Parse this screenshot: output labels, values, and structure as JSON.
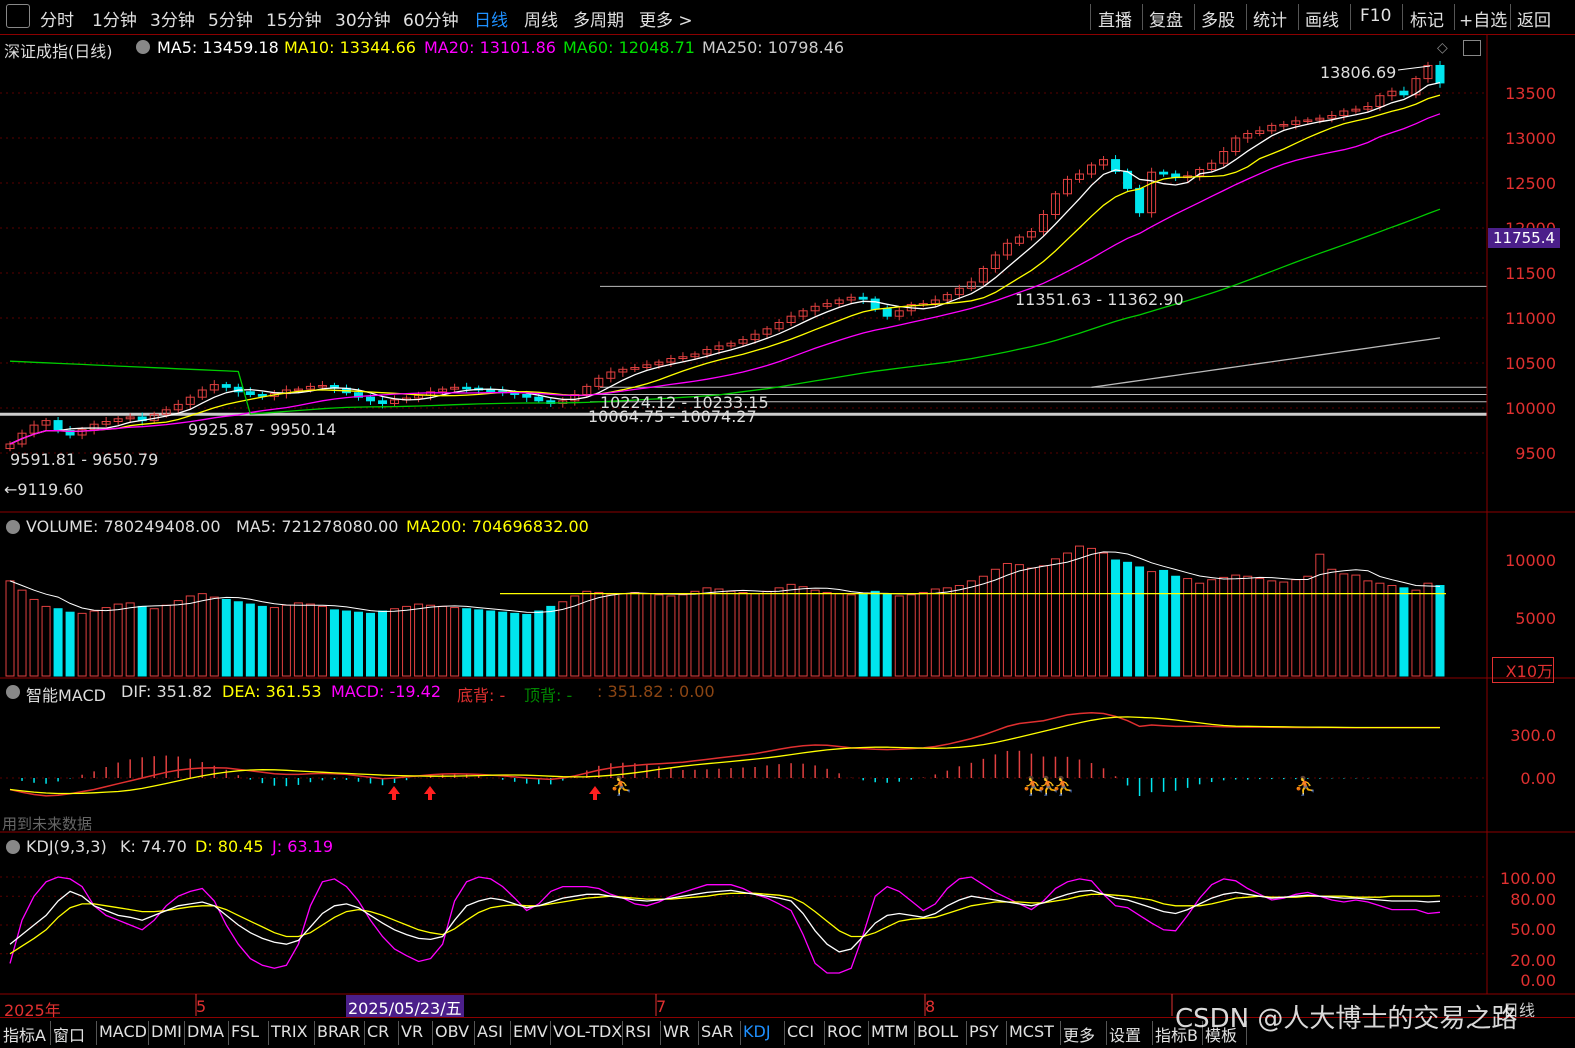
{
  "toolbar": {
    "left_items": [
      "分时",
      "1分钟",
      "3分钟",
      "5分钟",
      "15分钟",
      "30分钟",
      "60分钟",
      "日线",
      "周线",
      "多周期",
      "更多 >"
    ],
    "active": "日线",
    "right_items": [
      "直播",
      "复盘",
      "多股",
      "统计",
      "画线",
      "F10",
      "标记",
      "+自选",
      "返回"
    ]
  },
  "price_panel": {
    "title": "深证成指(日线)",
    "ma5": "MA5: 13459.18",
    "ma10": "MA10: 13344.66",
    "ma20": "MA20: 13101.86",
    "ma60": "MA60: 12048.71",
    "ma250": "MA250: 10798.46",
    "high_label": "13806.69",
    "current_price_tag": "11755.4",
    "annotations": [
      "11351.63 - 11362.90",
      "10224.12 - 10233.15",
      "10064.75 - 10074.27",
      "9925.87 - 9950.14",
      "9591.81 - 9650.79",
      "←9119.60"
    ],
    "axis_ticks": [
      "13500",
      "13000",
      "12500",
      "12000",
      "11500",
      "11000",
      "10500",
      "10000",
      "9500"
    ]
  },
  "volume_panel": {
    "vol": "VOLUME: 780249408.00",
    "ma5": "MA5: 721278080.00",
    "ma200": "MA200: 704696832.00",
    "axis_ticks": [
      "10000",
      "5000"
    ],
    "unit": "X10万"
  },
  "macd_panel": {
    "name": "智能MACD",
    "dif": "DIF: 351.82",
    "dea": "DEA: 361.53",
    "macd": "MACD: -19.42",
    "bottom_div": "底背: -",
    "top_div": "顶背: -",
    "extra": ": 351.82 : 0.00",
    "axis_ticks": [
      "300.0",
      "0.00"
    ],
    "note": "用到未来数据"
  },
  "kdj_panel": {
    "name": "KDJ(9,3,3)",
    "k": "K: 74.70",
    "d": "D: 80.45",
    "j": "J: 63.19",
    "axis_ticks": [
      "100.00",
      "80.00",
      "50.00",
      "20.00",
      "0.00"
    ]
  },
  "date_axis": {
    "labels": [
      "2025年",
      "5",
      "2025/05/23/五",
      "7",
      "8"
    ],
    "end_label": "日线"
  },
  "bottom_tabs": [
    "指标A",
    "窗口",
    "MACD",
    "DMI",
    "DMA",
    "FSL",
    "TRIX",
    "BRAR",
    "CR",
    "VR",
    "OBV",
    "ASI",
    "EMV",
    "VOL-TDX",
    "RSI",
    "WR",
    "SAR",
    "KDJ",
    "CCI",
    "ROC",
    "MTM",
    "BOLL",
    "PSY",
    "MCST",
    "更多",
    "设置",
    "指标B",
    "模板"
  ],
  "active_tab": "KDJ",
  "watermark": "CSDN @人大博士的交易之路",
  "colors": {
    "up": "#e04040",
    "down": "#00e5ee",
    "ma5": "#ffffff",
    "ma10": "#ffff00",
    "ma20": "#ff00ff",
    "ma60": "#00cc00",
    "ma250": "#bbbbbb",
    "axis": "#e03030",
    "tag": "#4b0082"
  },
  "chart_data": [
    {
      "type": "candlestick",
      "title": "深证成指(日线)",
      "ylim": [
        9100,
        13900
      ],
      "close": [
        9600,
        9720,
        9810,
        9860,
        9750,
        9700,
        9760,
        9820,
        9850,
        9880,
        9900,
        9860,
        9930,
        9980,
        10040,
        10120,
        10200,
        10260,
        10230,
        10180,
        10150,
        10130,
        10160,
        10200,
        10210,
        10240,
        10250,
        10220,
        10170,
        10120,
        10080,
        10050,
        10090,
        10110,
        10140,
        10180,
        10210,
        10230,
        10220,
        10200,
        10190,
        10170,
        10150,
        10120,
        10080,
        10050,
        10080,
        10150,
        10240,
        10330,
        10400,
        10430,
        10450,
        10480,
        10510,
        10550,
        10570,
        10600,
        10650,
        10690,
        10720,
        10760,
        10820,
        10880,
        10950,
        11020,
        11080,
        11130,
        11160,
        11200,
        11230,
        11210,
        11100,
        11020,
        11080,
        11150,
        11160,
        11200,
        11260,
        11330,
        11400,
        11550,
        11700,
        11830,
        11900,
        11960,
        12150,
        12380,
        12540,
        12600,
        12700,
        12760,
        12630,
        12440,
        12170,
        12620,
        12600,
        12560,
        12580,
        12650,
        12720,
        12850,
        13000,
        13050,
        13080,
        13140,
        13150,
        13190,
        13200,
        13220,
        13250,
        13300,
        13320,
        13350,
        13470,
        13520,
        13480,
        13660,
        13806,
        13612
      ]
    },
    {
      "type": "bar",
      "title": "VOLUME",
      "ylim": [
        0,
        12000
      ],
      "values": [
        8200,
        7400,
        6600,
        6000,
        5800,
        5500,
        5400,
        5600,
        5900,
        6200,
        6300,
        6000,
        5800,
        6100,
        6500,
        6900,
        7100,
        6800,
        6600,
        6400,
        6200,
        6000,
        5900,
        6100,
        6300,
        6200,
        6000,
        5700,
        5600,
        5500,
        5400,
        5600,
        5800,
        6000,
        6200,
        6100,
        6000,
        5900,
        5800,
        5700,
        5600,
        5500,
        5400,
        5300,
        5600,
        6000,
        6400,
        6900,
        7300,
        7200,
        7000,
        7100,
        7200,
        7100,
        7000,
        6900,
        7000,
        7300,
        7600,
        7500,
        7300,
        7200,
        7100,
        7300,
        7600,
        7900,
        7700,
        7400,
        7200,
        7100,
        7000,
        7100,
        7300,
        7100,
        6900,
        7000,
        7200,
        7500,
        7600,
        7800,
        8200,
        8600,
        9200,
        9700,
        9600,
        9300,
        9500,
        10100,
        10600,
        11200,
        11000,
        10600,
        10000,
        9800,
        9400,
        9000,
        9100,
        8600,
        8400,
        8000,
        8300,
        8500,
        8700,
        8600,
        8400,
        8200,
        8100,
        8300,
        8600,
        10500,
        9200,
        8800,
        8700,
        8200,
        8000,
        7800,
        7600,
        7400,
        8000,
        7800
      ]
    },
    {
      "type": "line",
      "title": "智能MACD",
      "ylim": [
        -150,
        450
      ],
      "series": [
        {
          "name": "DIF",
          "values": [
            -80,
            -100,
            -115,
            -125,
            -120,
            -110,
            -95,
            -80,
            -60,
            -40,
            -20,
            0,
            20,
            40,
            55,
            65,
            70,
            72,
            70,
            60,
            50,
            40,
            30,
            25,
            25,
            30,
            32,
            30,
            25,
            15,
            5,
            -5,
            0,
            8,
            15,
            22,
            28,
            30,
            28,
            25,
            20,
            15,
            8,
            0,
            -5,
            -10,
            0,
            15,
            35,
            55,
            70,
            80,
            88,
            95,
            100,
            105,
            110,
            120,
            130,
            140,
            150,
            160,
            170,
            185,
            200,
            215,
            225,
            230,
            228,
            220,
            210,
            205,
            200,
            198,
            200,
            205,
            210,
            220,
            235,
            255,
            275,
            300,
            330,
            360,
            380,
            390,
            400,
            420,
            440,
            450,
            455,
            450,
            430,
            400,
            360,
            370,
            365,
            360,
            360,
            362,
            360,
            358,
            356,
            355,
            355,
            354,
            353,
            352,
            352,
            352,
            352,
            351,
            351,
            351,
            352,
            352,
            352,
            352,
            352,
            352
          ]
        }
      ]
    },
    {
      "type": "line",
      "title": "KDJ(9,3,3)",
      "ylim": [
        0,
        110
      ],
      "series": [
        {
          "name": "K",
          "values": [
            30,
            40,
            50,
            60,
            75,
            85,
            80,
            70,
            65,
            60,
            58,
            55,
            60,
            65,
            70,
            72,
            74,
            70,
            60,
            50,
            42,
            36,
            32,
            30,
            34,
            48,
            62,
            70,
            72,
            68,
            60,
            52,
            45,
            40,
            36,
            35,
            38,
            55,
            70,
            75,
            78,
            76,
            72,
            68,
            70,
            74,
            78,
            80,
            82,
            82,
            80,
            78,
            76,
            75,
            76,
            78,
            80,
            82,
            84,
            85,
            86,
            84,
            82,
            80,
            78,
            75,
            62,
            44,
            30,
            22,
            25,
            38,
            52,
            60,
            62,
            60,
            58,
            62,
            70,
            76,
            80,
            78,
            76,
            74,
            72,
            70,
            73,
            78,
            82,
            85,
            86,
            82,
            78,
            76,
            72,
            68,
            64,
            62,
            66,
            72,
            78,
            82,
            84,
            82,
            80,
            78,
            79,
            80,
            81,
            80,
            79,
            78,
            78,
            77,
            76,
            75,
            75,
            75,
            74,
            74.7
          ]
        },
        {
          "name": "D",
          "values": [
            20,
            28,
            36,
            45,
            58,
            68,
            72,
            72,
            70,
            68,
            66,
            64,
            64,
            65,
            67,
            69,
            70,
            70,
            66,
            60,
            54,
            48,
            42,
            38,
            38,
            42,
            50,
            58,
            64,
            66,
            64,
            60,
            55,
            50,
            45,
            42,
            40,
            46,
            55,
            63,
            68,
            70,
            71,
            70,
            70,
            72,
            74,
            76,
            78,
            79,
            80,
            79,
            78,
            77,
            77,
            77,
            78,
            79,
            80,
            82,
            83,
            83,
            83,
            82,
            81,
            79,
            73,
            64,
            54,
            44,
            38,
            38,
            42,
            48,
            54,
            56,
            57,
            58,
            62,
            66,
            70,
            72,
            74,
            74,
            74,
            73,
            73,
            75,
            77,
            80,
            82,
            82,
            81,
            80,
            78,
            76,
            72,
            70,
            70,
            70,
            72,
            75,
            78,
            79,
            80,
            79,
            79,
            79,
            80,
            80,
            80,
            80,
            79,
            79,
            79,
            80,
            80,
            80,
            80,
            80.45
          ]
        },
        {
          "name": "J",
          "values": [
            10,
            55,
            80,
            95,
            100,
            98,
            90,
            70,
            60,
            55,
            50,
            45,
            55,
            70,
            80,
            85,
            88,
            75,
            50,
            30,
            15,
            8,
            5,
            8,
            30,
            70,
            95,
            98,
            90,
            75,
            55,
            38,
            25,
            18,
            12,
            15,
            30,
            75,
            95,
            100,
            98,
            90,
            78,
            65,
            72,
            85,
            90,
            90,
            90,
            88,
            82,
            78,
            72,
            70,
            74,
            80,
            84,
            88,
            92,
            92,
            92,
            88,
            82,
            78,
            72,
            65,
            40,
            10,
            0,
            0,
            5,
            40,
            80,
            90,
            85,
            75,
            65,
            72,
            88,
            98,
            100,
            92,
            84,
            78,
            72,
            66,
            75,
            88,
            95,
            98,
            96,
            82,
            70,
            68,
            60,
            52,
            45,
            44,
            60,
            78,
            92,
            98,
            96,
            88,
            82,
            76,
            78,
            82,
            84,
            80,
            76,
            74,
            76,
            74,
            70,
            66,
            66,
            66,
            62,
            63.19
          ]
        }
      ]
    }
  ]
}
